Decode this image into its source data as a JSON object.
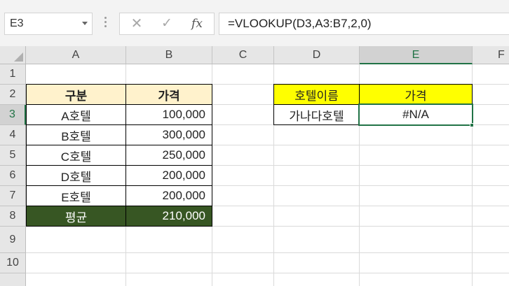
{
  "formula_bar": {
    "name_box": "E3",
    "cancel_icon": "✕",
    "enter_icon": "✓",
    "fx_label": "fx",
    "formula": "=VLOOKUP(D3,A3:B7,2,0)"
  },
  "columns": [
    "A",
    "B",
    "C",
    "D",
    "E",
    "F"
  ],
  "rows": [
    "1",
    "2",
    "3",
    "4",
    "5",
    "6",
    "7",
    "8",
    "9",
    "10"
  ],
  "table1": {
    "header": {
      "category": "구분",
      "price": "가격"
    },
    "rows": [
      {
        "name": "A호텔",
        "price": "100,000"
      },
      {
        "name": "B호텔",
        "price": "300,000"
      },
      {
        "name": "C호텔",
        "price": "250,000"
      },
      {
        "name": "D호텔",
        "price": "200,000"
      },
      {
        "name": "E호텔",
        "price": "200,000"
      }
    ],
    "average": {
      "label": "평균",
      "value": "210,000"
    }
  },
  "lookup": {
    "header": {
      "hotel_name": "호텔이름",
      "price": "가격"
    },
    "input": "가나다호텔",
    "result": "#N/A"
  },
  "selection": {
    "active_cell": "E3"
  },
  "colors": {
    "header_fill": "#FFF2CC",
    "average_fill": "#375623",
    "lookup_header_fill": "#FFFF00",
    "accent": "#217346"
  }
}
